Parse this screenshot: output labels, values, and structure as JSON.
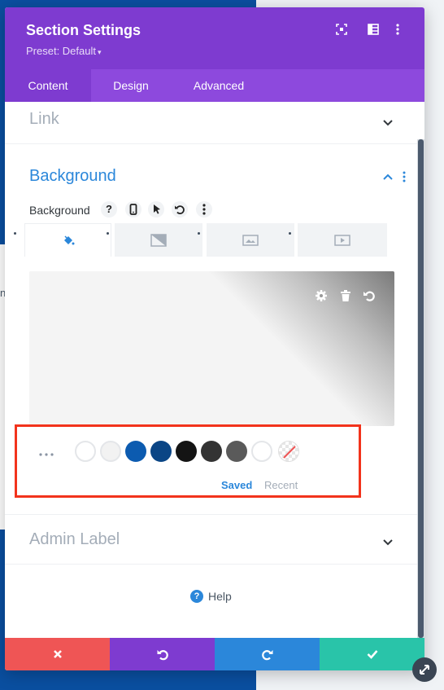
{
  "modal": {
    "title": "Section Settings",
    "preset": "Preset: Default",
    "header_icons": [
      "fullscreen-icon",
      "columns-icon",
      "more-vertical-icon"
    ]
  },
  "tabs": [
    {
      "label": "Content",
      "active": true
    },
    {
      "label": "Design",
      "active": false
    },
    {
      "label": "Advanced",
      "active": false
    }
  ],
  "sections": {
    "link": {
      "title": "Link",
      "expanded": false
    },
    "background": {
      "title": "Background",
      "expanded": true,
      "option_label": "Background",
      "option_icons": [
        "help-icon",
        "phone-icon",
        "pointer-icon",
        "undo-icon",
        "more-icon"
      ],
      "help_glyph": "?",
      "type_tabs": [
        {
          "icon": "paint-bucket-icon",
          "active": true
        },
        {
          "icon": "gradient-icon",
          "active": false
        },
        {
          "icon": "image-icon",
          "active": false
        },
        {
          "icon": "video-icon",
          "active": false
        }
      ],
      "preview_icons": [
        "gear-icon",
        "trash-icon",
        "reset-icon"
      ]
    },
    "admin_label": {
      "title": "Admin Label",
      "expanded": false
    }
  },
  "swatches": {
    "colors": [
      "#ffffff",
      "#f2f2f2",
      "#0c5bb0",
      "#0a4585",
      "#141414",
      "#333333",
      "#5a5a5a",
      "#ffffff"
    ],
    "none_swatch": "no-color-icon",
    "saved_label": "Saved",
    "recent_label": "Recent"
  },
  "help": {
    "label": "Help",
    "glyph": "?"
  },
  "footer": [
    "discard-icon",
    "undo-icon",
    "redo-icon",
    "check-icon"
  ],
  "colors": {
    "purple": "#7e3bd0",
    "blue": "#2b87da",
    "red": "#ef5555",
    "green": "#29c4a9",
    "highlight": "#f2331c"
  },
  "backdrop": {
    "letter": "n"
  }
}
